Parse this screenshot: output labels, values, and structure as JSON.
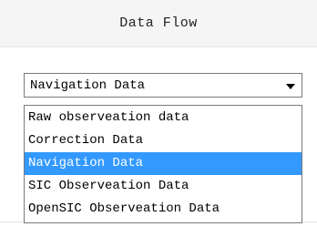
{
  "header": {
    "title": "Data Flow"
  },
  "select": {
    "value": "Navigation Data",
    "icon": "chevron-down-icon"
  },
  "dropdown": {
    "options": [
      {
        "label": "Raw observeation data",
        "selected": false
      },
      {
        "label": "Correction Data",
        "selected": false
      },
      {
        "label": "Navigation Data",
        "selected": true
      },
      {
        "label": "SIC Observeation Data",
        "selected": false
      },
      {
        "label": "OpenSIC Observeation Data",
        "selected": false
      }
    ]
  },
  "colors": {
    "highlight": "#3399ff",
    "header_bg": "#f5f5f5",
    "border": "#7a7a7a"
  }
}
